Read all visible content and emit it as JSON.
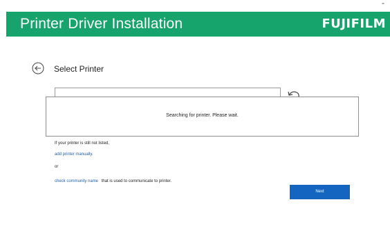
{
  "window": {
    "minimize_symbol": "-"
  },
  "header": {
    "title": "Printer Driver Installation",
    "brand": "FUJIFILM",
    "background": "#16a36c"
  },
  "page": {
    "title": "Select Printer",
    "back_icon": "back-arrow-icon",
    "refresh_icon": "refresh-icon"
  },
  "dialog": {
    "message": "Searching for printer. Please wait."
  },
  "help": {
    "not_listed": "If your printer is still not listed,",
    "add_manual_link": "add printer manually.",
    "or": "or",
    "community_link": "check community name",
    "community_rest": "that is used to communicate to printer."
  },
  "actions": {
    "next_label": "Next",
    "accent": "#1365c0"
  }
}
